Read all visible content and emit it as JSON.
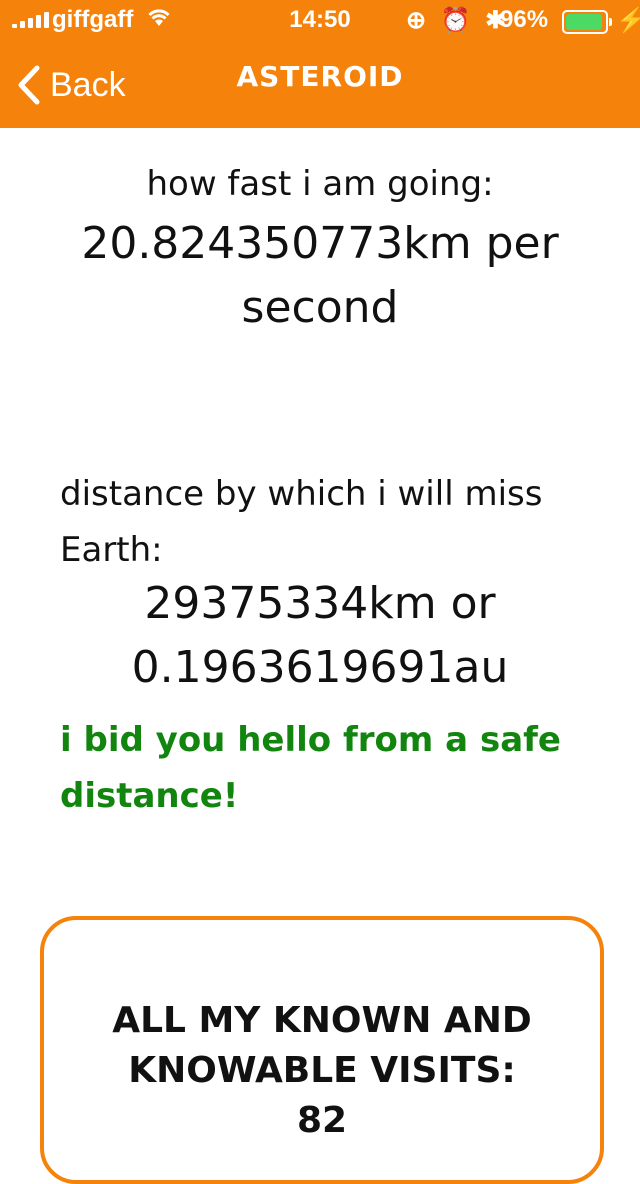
{
  "status_bar": {
    "carrier": "giffgaff",
    "time": "14:50",
    "battery_percent": "96%",
    "battery_level": 0.96,
    "icons": [
      "signal-icon",
      "wifi-icon",
      "rotation-lock-icon",
      "alarm-icon",
      "bluetooth-icon",
      "battery-icon",
      "charging-icon"
    ]
  },
  "nav": {
    "back_label": "Back",
    "title": "ASTEROID"
  },
  "speed": {
    "label": "how fast i am going:",
    "value": "20.824350773km per second"
  },
  "miss_distance": {
    "label": "distance by which i will miss Earth:",
    "value": "29375334km or 0.1963619691au"
  },
  "greeting": "i bid you hello from a safe distance!",
  "visits": {
    "label": "all my known and knowable visits:",
    "count": "82"
  },
  "colors": {
    "accent": "#f5820a",
    "greeting": "#12850f",
    "battery": "#4cd964"
  }
}
